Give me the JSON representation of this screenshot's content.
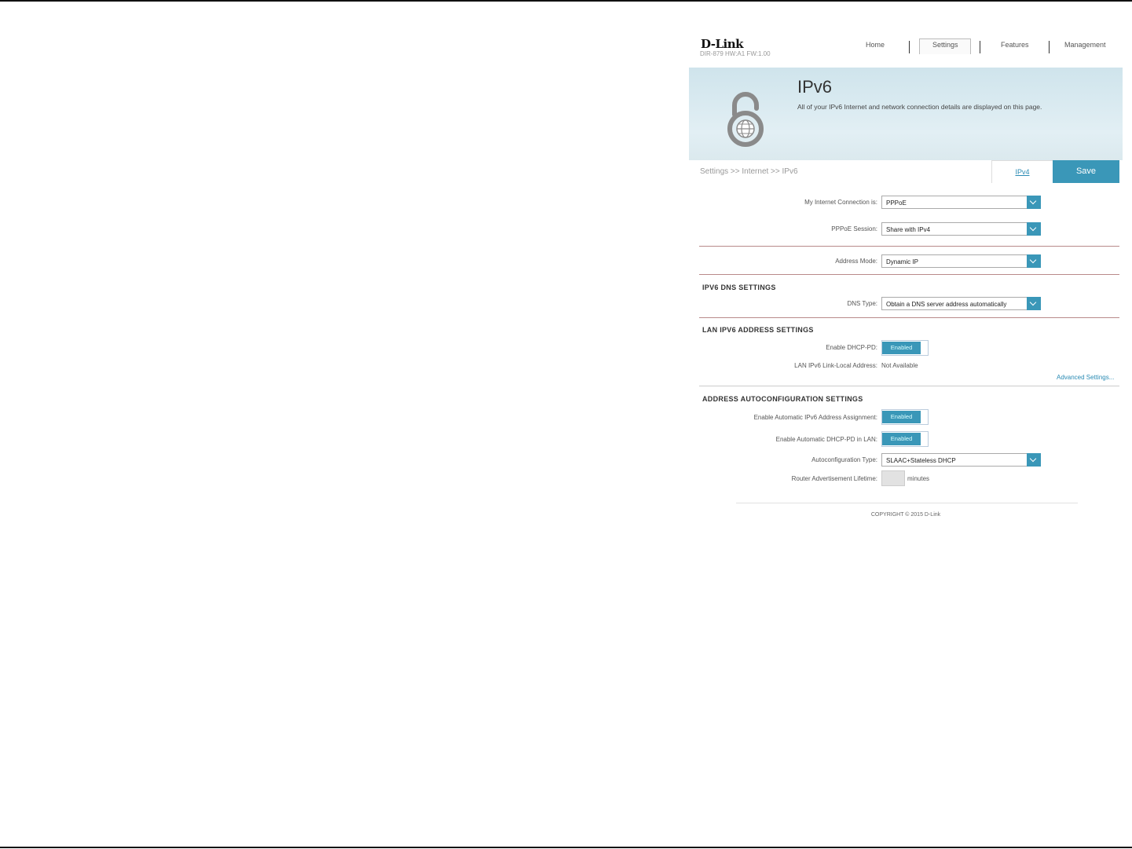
{
  "header": {
    "logo": "D-Link",
    "model": "DIR-879 HW:A1 FW:1.00",
    "nav": [
      {
        "label": "Home"
      },
      {
        "label": "Settings"
      },
      {
        "label": "Features"
      },
      {
        "label": "Management"
      }
    ]
  },
  "banner": {
    "title": "IPv6",
    "description": "All of your IPv6 Internet and network connection details are displayed on this page.",
    "icon": "ipv6-lock-globe-icon"
  },
  "toolbar": {
    "breadcrumb": "Settings >> Internet >> IPv6",
    "ipv4_link": "IPv4",
    "save_label": "Save"
  },
  "connection": {
    "my_connection_label": "My Internet Connection is:",
    "my_connection_value": "PPPoE",
    "pppoe_session_label": "PPPoE Session:",
    "pppoe_session_value": "Share with IPv4",
    "address_mode_label": "Address Mode:",
    "address_mode_value": "Dynamic IP"
  },
  "dns": {
    "title": "IPV6 DNS SETTINGS",
    "type_label": "DNS Type:",
    "type_value": "Obtain a DNS server address automatically"
  },
  "lan": {
    "title": "LAN IPV6 ADDRESS SETTINGS",
    "dhcp_pd_label": "Enable DHCP-PD:",
    "dhcp_pd_value": "Enabled",
    "link_local_label": "LAN IPv6 Link-Local Address:",
    "link_local_value": "Not Available",
    "advanced_link": "Advanced Settings..."
  },
  "autoconfig": {
    "title": "ADDRESS AUTOCONFIGURATION SETTINGS",
    "auto_assign_label": "Enable Automatic IPv6 Address Assignment:",
    "auto_assign_value": "Enabled",
    "auto_dhcp_pd_label": "Enable Automatic DHCP-PD in LAN:",
    "auto_dhcp_pd_value": "Enabled",
    "type_label": "Autoconfiguration Type:",
    "type_value": "SLAAC+Stateless DHCP",
    "lifetime_label": "Router Advertisement Lifetime:",
    "lifetime_value": "",
    "lifetime_units": "minutes"
  },
  "footer": {
    "copyright": "COPYRIGHT © 2015 D-Link"
  },
  "colors": {
    "accent": "#3a97b8",
    "link": "#2a8bb4"
  }
}
